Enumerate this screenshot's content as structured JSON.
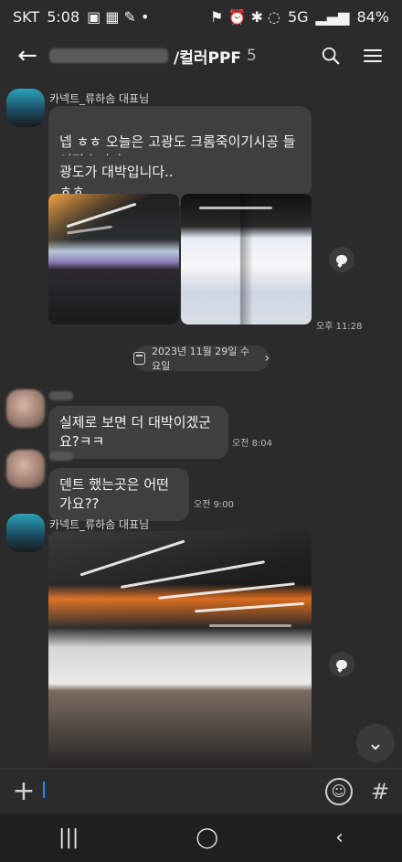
{
  "status": {
    "carrier": "SKT",
    "time": "5:08",
    "network": "5G",
    "battery": "84%"
  },
  "header": {
    "title": "/컬러PPF",
    "member_count": "5"
  },
  "date_divider": "2023년 11월 29일 수요일",
  "messages": [
    {
      "sender": "카넥트_류하솜 대표님",
      "text": "넵 ㅎㅎ 오늘은 고광도 크롬죽이기시공 들어갔습니다\nㅎㅎ"
    },
    {
      "sender": "카넥트_류하솜 대표님",
      "text": "광도가 대박입니다.. ㅎㅎ",
      "time": "오후 11:28"
    },
    {
      "sender": "",
      "text": "실제로 보면 더 대박이겠군요?ㅋㅋ",
      "time": "오전 8:04"
    },
    {
      "sender": "",
      "text": "덴트 했는곳은 어떤가요??",
      "time": "오전 9:00"
    },
    {
      "sender": "카넥트_류하솜 대표님",
      "text": ""
    }
  ],
  "composer": {
    "placeholder": ""
  }
}
